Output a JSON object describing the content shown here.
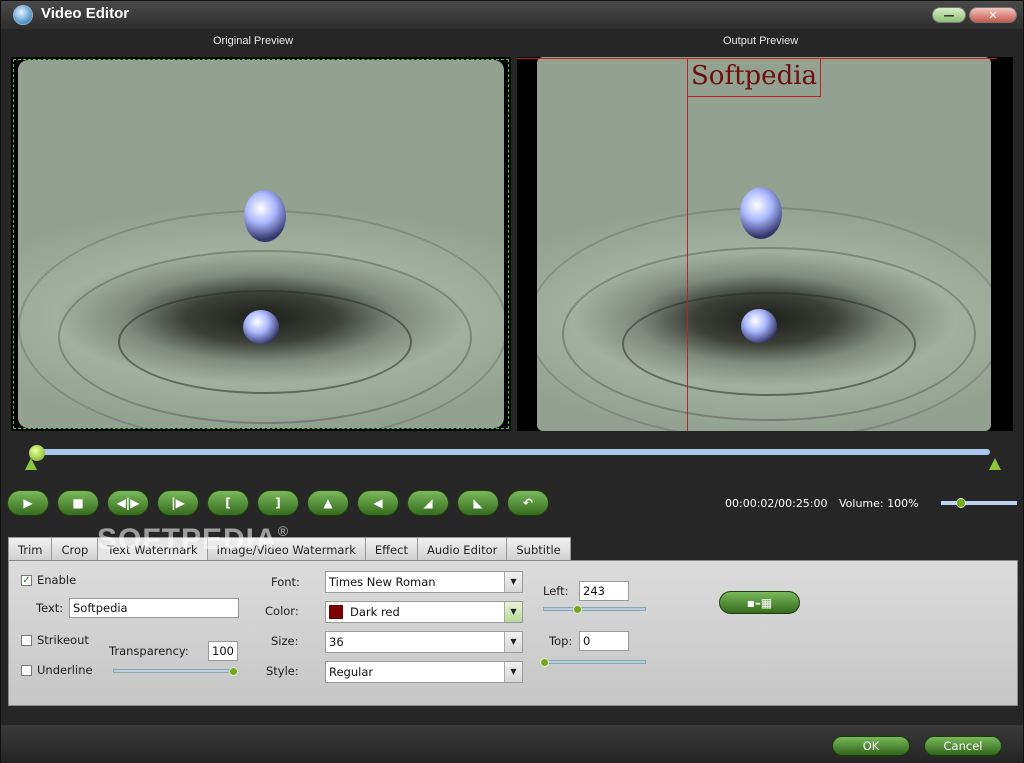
{
  "window": {
    "title": "Video Editor",
    "minimize_icon": "minimize-icon",
    "close_icon": "close-icon"
  },
  "preview": {
    "original_label": "Original Preview",
    "output_label": "Output Preview",
    "watermark_text": "Softpedia",
    "watermark_color": "#6b0e0e"
  },
  "timeline": {
    "position_fraction": 0.0
  },
  "controls": {
    "buttons": [
      "play-icon",
      "stop-icon",
      "prev-frame-icon",
      "next-frame-icon",
      "mark-in-icon",
      "mark-out-icon",
      "flip-vertical-icon",
      "flip-horizontal-icon",
      "rotate-left-icon",
      "rotate-right-icon",
      "undo-icon"
    ],
    "time": "00:00:02/00:25:00",
    "volume_label": "Volume:",
    "volume_value": "100%"
  },
  "tabs": [
    "Trim",
    "Crop",
    "Text Watermark",
    "Image/Video Watermark",
    "Effect",
    "Audio Editor",
    "Subtitle"
  ],
  "active_tab": "Text Watermark",
  "watermark_panel": {
    "enable_label": "Enable",
    "enable_checked": true,
    "text_label": "Text:",
    "text_value": "Softpedia",
    "strikeout_label": "Strikeout",
    "underline_label": "Underline",
    "transparency_label": "Transparency:",
    "transparency_value": "100",
    "font_label": "Font:",
    "font_value": "Times New Roman",
    "color_label": "Color:",
    "color_value": "Dark red",
    "color_swatch": "#7a0000",
    "size_label": "Size:",
    "size_value": "36",
    "style_label": "Style:",
    "style_value": "Regular",
    "left_label": "Left:",
    "left_value": "243",
    "top_label": "Top:",
    "top_value": "0",
    "position_button_icon": "position-grid-icon"
  },
  "footer": {
    "ok_label": "OK",
    "cancel_label": "Cancel"
  },
  "overlay_watermark": "SOFTPEDIA®",
  "accent_color": "#74a81c"
}
